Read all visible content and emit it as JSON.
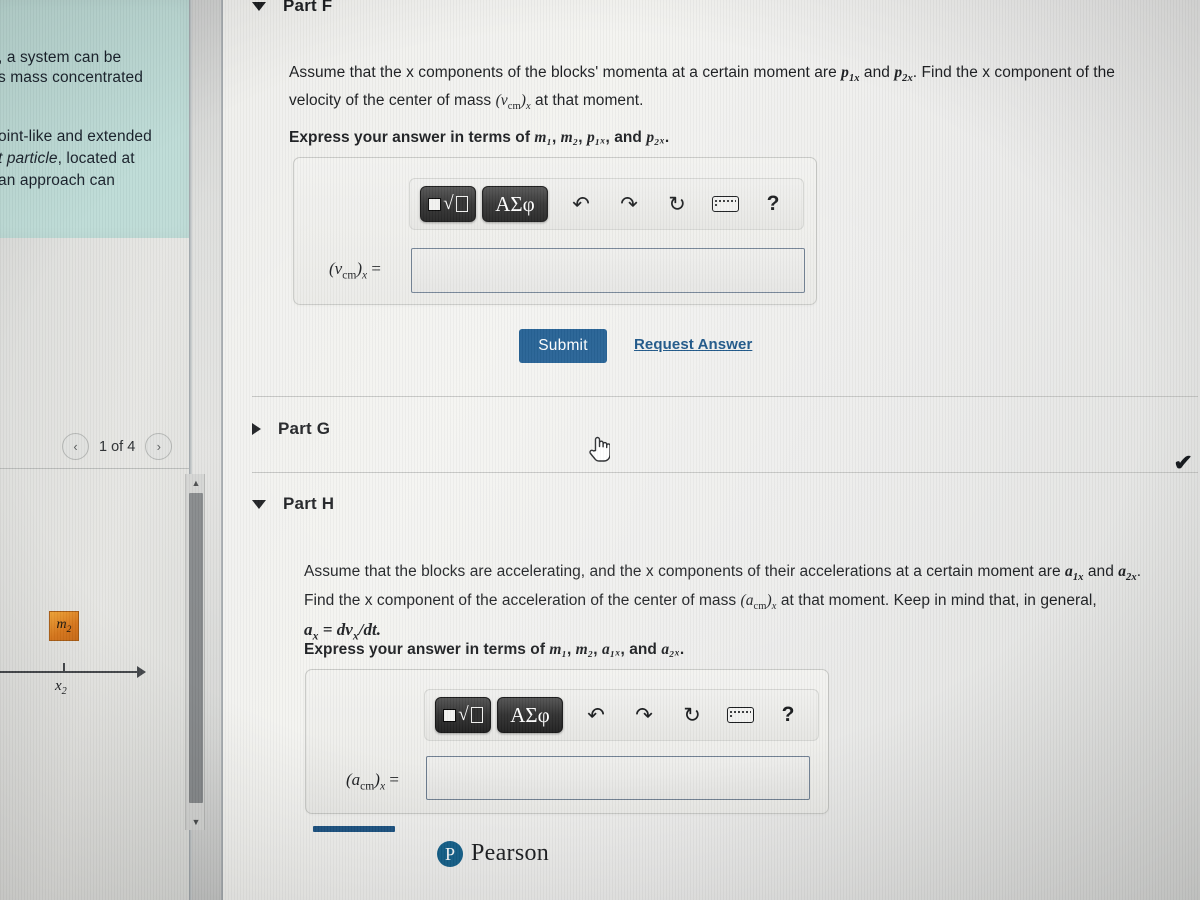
{
  "app": {
    "brand": "Pearson",
    "brand_mark": "P",
    "brand_color": "#14608a",
    "accent_color": "#14558c",
    "link_color": "#0f4c81"
  },
  "left_pane": {
    "hint_panel": {
      "bg_color": "#bedcd7",
      "lines": [
        ", a system can be",
        "s mass concentrated",
        "",
        "oint-like and extended",
        "t particle, located at",
        "an approach can"
      ],
      "italic_fragment": "t particle"
    },
    "pager": {
      "prev_icon": "chevron-left-icon",
      "prev_glyph": "‹",
      "label": "1 of 4",
      "next_icon": "chevron-right-icon",
      "next_glyph": "›"
    },
    "scrollbar": {
      "up_glyph": "▲",
      "down_glyph": "▼"
    },
    "figure": {
      "block_label": "m",
      "block_sub": "2",
      "block_color": "#d8761a",
      "axis_label": "x",
      "axis_sub": "2"
    }
  },
  "main": {
    "parts": [
      {
        "id": "part-f",
        "title": "Part F",
        "expanded": true,
        "toggle_icon": "triangle-down-icon",
        "prompt_1": "Assume that the x components of the blocks' momenta at a certain moment are ",
        "prompt_1_var_a": "p",
        "prompt_1_var_a_sub": "1x",
        "prompt_1_mid": " and ",
        "prompt_1_var_b": "p",
        "prompt_1_var_b_sub": "2x",
        "prompt_1_tail": ". Find the x component of the",
        "prompt_2_pre": "velocity of the center of mass ",
        "prompt_2_math": "(v",
        "prompt_2_math_sub": "cm",
        "prompt_2_math_mid": ")",
        "prompt_2_math_sub2": "x",
        "prompt_2_tail": " at that moment.",
        "express": "Express your answer in terms of ",
        "express_vars": [
          "m₁",
          "m₂",
          "p₁ₓ",
          "p₂ₓ"
        ],
        "express_tail": ".",
        "answer_label_main": "(v",
        "answer_label_sub": "cm",
        "answer_label_close": ")",
        "answer_label_sub2": "x",
        "answer_label_eq": " =",
        "answer_value": "",
        "answer_placeholder": "",
        "submit_label": "Submit",
        "request_answer_label": "Request Answer"
      },
      {
        "id": "part-g",
        "title": "Part G",
        "expanded": false,
        "toggle_icon": "triangle-right-icon"
      },
      {
        "id": "part-h",
        "title": "Part H",
        "expanded": true,
        "toggle_icon": "triangle-down-icon",
        "prompt_1": "Assume that the blocks are accelerating, and the x components of their accelerations at a certain moment are ",
        "prompt_1_var_a": "a",
        "prompt_1_var_a_sub": "1x",
        "prompt_1_mid": " and ",
        "prompt_1_var_b": "a",
        "prompt_1_var_b_sub": "2x",
        "prompt_1_tail": ".",
        "prompt_2_pre": "Find the x component of the acceleration of the center of mass ",
        "prompt_2_math": "(a",
        "prompt_2_math_sub": "cm",
        "prompt_2_math_mid": ")",
        "prompt_2_math_sub2": "x",
        "prompt_2_tail": " at that moment. Keep in mind that, in general,",
        "prompt_3_formula": "a",
        "prompt_3_formula_sub": "x",
        "prompt_3_formula_rest": " = dv",
        "prompt_3_formula_sub2": "x",
        "prompt_3_formula_tail": "/dt.",
        "express": "Express your answer in terms of ",
        "express_vars": [
          "m₁",
          "m₂",
          "a₁ₓ",
          "a₂ₓ"
        ],
        "express_tail": ".",
        "answer_label_main": "(a",
        "answer_label_sub": "cm",
        "answer_label_close": ")",
        "answer_label_sub2": "x",
        "answer_label_eq": " =",
        "answer_value": "",
        "answer_placeholder": ""
      }
    ],
    "toolbar": {
      "template_key_label": "√",
      "template_key_name": "math-template-button",
      "greek_key_label": "ΑΣφ",
      "undo_glyph": "↶",
      "redo_glyph": "↷",
      "reset_glyph": "↻",
      "keyboard_glyph": "keyboard",
      "help_glyph": "?"
    }
  },
  "overlay": {
    "cursor_icon": "pointing-hand-cursor",
    "check_icon": "checkmark-icon",
    "check_glyph": "✔"
  }
}
